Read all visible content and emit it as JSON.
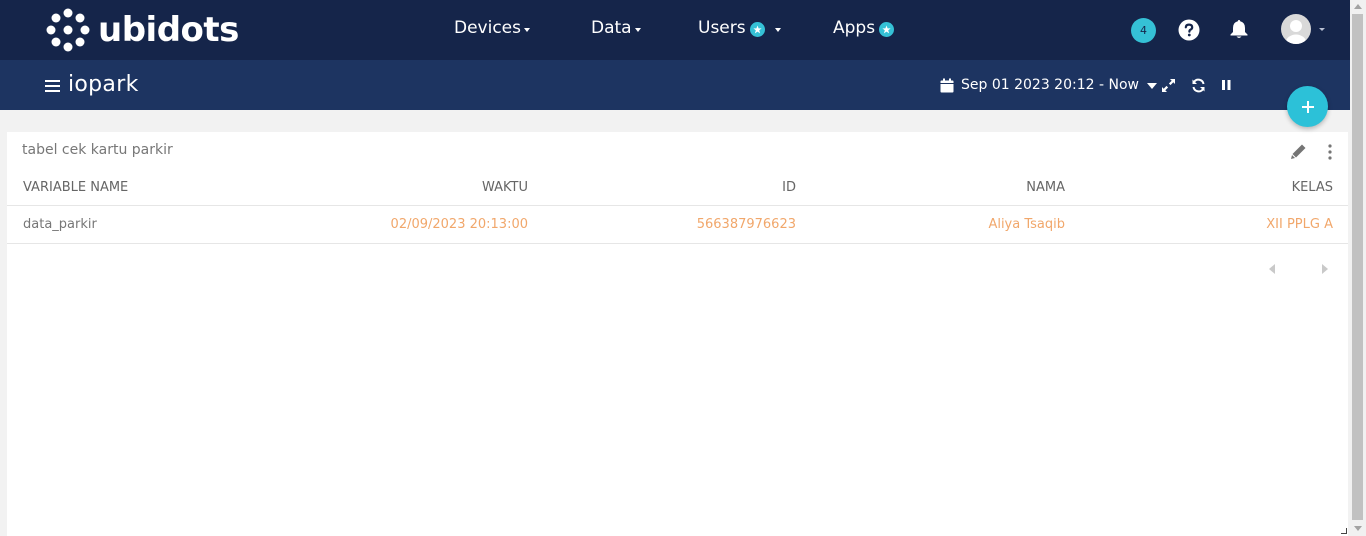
{
  "app": {
    "logo_text": "ubidots",
    "brand_color": "#15254a",
    "accent_color": "#35c1d6"
  },
  "nav": {
    "items": [
      {
        "label": "Devices",
        "has_caret": true,
        "has_star": false
      },
      {
        "label": "Data",
        "has_caret": true,
        "has_star": false
      },
      {
        "label": "Users",
        "has_caret": true,
        "has_star": true
      },
      {
        "label": "Apps",
        "has_caret": false,
        "has_star": true
      }
    ],
    "notification_count": "4",
    "icons": [
      "help-icon",
      "bell-icon",
      "avatar"
    ]
  },
  "dashboard": {
    "title": "iopark",
    "date_range": "Sep 01 2023 20:12 - Now",
    "controls": [
      "calendar-icon",
      "expand-icon",
      "refresh-icon",
      "pause-icon"
    ]
  },
  "widget": {
    "title": "tabel cek kartu parkir",
    "columns": [
      "VARIABLE NAME",
      "WAKTU",
      "ID",
      "NAMA",
      "KELAS"
    ],
    "rows": [
      [
        "data_parkir",
        "02/09/2023 20:13:00",
        "566387976623",
        "Aliya Tsaqib",
        "XII PPLG A"
      ]
    ],
    "value_color": "#f1a76b"
  }
}
